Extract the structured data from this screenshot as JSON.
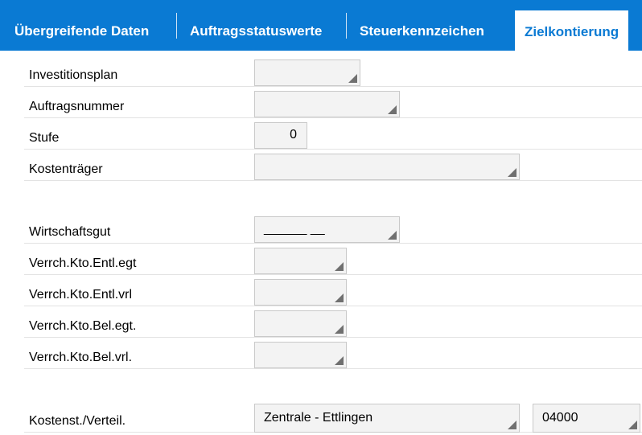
{
  "tabs": [
    {
      "label": "Übergreifende Daten",
      "active": false
    },
    {
      "label": "Auftragsstatuswerte",
      "active": false
    },
    {
      "label": "Steuerkennzeichen",
      "active": false
    },
    {
      "label": "Zielkontierung",
      "active": true
    }
  ],
  "fields": {
    "investitionsplan": {
      "label": "Investitionsplan",
      "value": ""
    },
    "auftragsnummer": {
      "label": "Auftragsnummer",
      "value": ""
    },
    "stufe": {
      "label": "Stufe",
      "value": "0"
    },
    "kostentraeger": {
      "label": "Kostenträger",
      "value": ""
    },
    "wirtschaftsgut": {
      "label": "Wirtschaftsgut",
      "value": "______ __"
    },
    "verrch_entl_egt": {
      "label": "Verrch.Kto.Entl.egt",
      "value": ""
    },
    "verrch_entl_vrl": {
      "label": "Verrch.Kto.Entl.vrl",
      "value": ""
    },
    "verrch_bel_egt": {
      "label": "Verrch.Kto.Bel.egt.",
      "value": ""
    },
    "verrch_bel_vrl": {
      "label": "Verrch.Kto.Bel.vrl.",
      "value": ""
    },
    "kostenst": {
      "label": "Kostenst./Verteil.",
      "value": "Zentrale - Ettlingen",
      "code": "04000"
    }
  },
  "colors": {
    "tab_bar": "#0a7ad3",
    "field_bg": "#f3f3f3"
  },
  "icons": {
    "field_corner": "dropdown-corner-icon"
  }
}
